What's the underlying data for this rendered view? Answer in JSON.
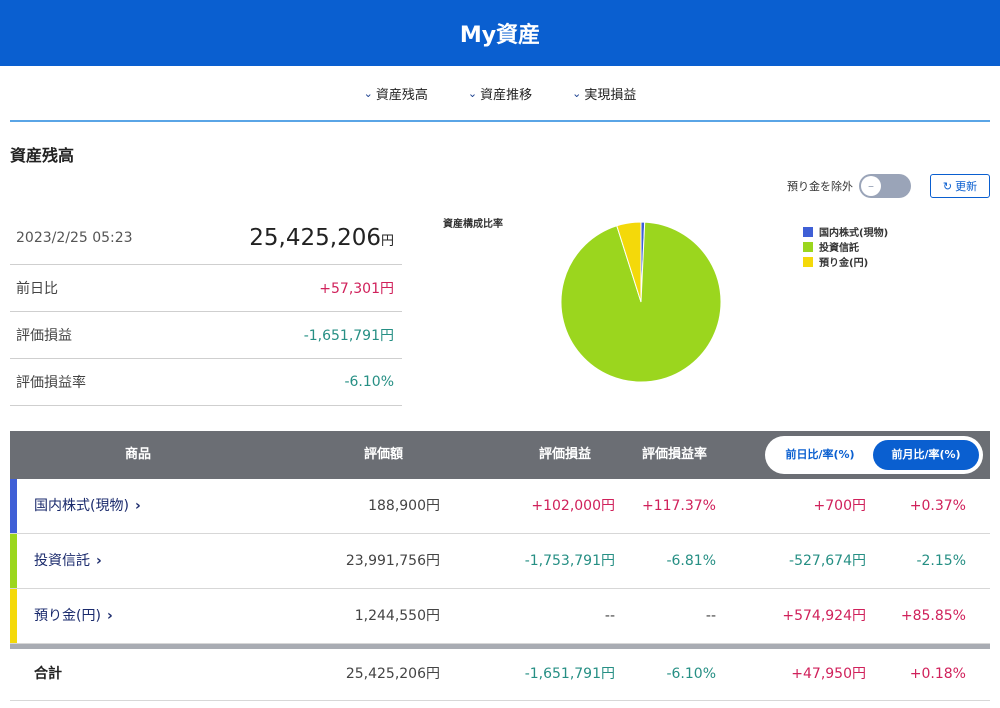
{
  "header": {
    "title": "My資産"
  },
  "tabs": [
    {
      "label": "資産残高"
    },
    {
      "label": "資産推移"
    },
    {
      "label": "実現損益"
    }
  ],
  "section": {
    "title": "資産残高"
  },
  "controls": {
    "exclude_deposit_label": "預り金を除外",
    "refresh_label": "更新"
  },
  "summary": {
    "datetime": "2023/2/25 05:23",
    "total_value": "25,425,206",
    "unit": "円",
    "rows": [
      {
        "label": "前日比",
        "value": "+57,301円"
      },
      {
        "label": "評価損益",
        "value": "-1,651,791円"
      },
      {
        "label": "評価損益率",
        "value": "-6.10%"
      }
    ]
  },
  "chart_data": {
    "type": "pie",
    "title": "資産構成比率",
    "labels": [
      "国内株式(現物)",
      "投資信託",
      "預り金(円)"
    ],
    "values": [
      188900,
      23991756,
      1244550
    ],
    "colors": [
      "#3f5fd6",
      "#9bd61e",
      "#f4d90a"
    ]
  },
  "table": {
    "headers": {
      "product": "商品",
      "value": "評価額",
      "pl": "評価損益",
      "pl_rate": "評価損益率"
    },
    "toggle": {
      "day": "前日比/率(%)",
      "month": "前月比/率(%)"
    },
    "rows": [
      {
        "name": "国内株式(現物)",
        "value": "188,900円",
        "pl": "+102,000円",
        "pl_rate": "+117.37%",
        "change": "+700円",
        "change_rate": "+0.37%",
        "color": "#3f5fd6"
      },
      {
        "name": "投資信託",
        "value": "23,991,756円",
        "pl": "-1,753,791円",
        "pl_rate": "-6.81%",
        "change": "-527,674円",
        "change_rate": "-2.15%",
        "color": "#9bd61e"
      },
      {
        "name": "預り金(円)",
        "value": "1,244,550円",
        "pl": "--",
        "pl_rate": "--",
        "change": "+574,924円",
        "change_rate": "+85.85%",
        "color": "#f4d90a"
      }
    ],
    "total": {
      "name": "合計",
      "value": "25,425,206円",
      "pl": "-1,651,791円",
      "pl_rate": "-6.10%",
      "change": "+47,950円",
      "change_rate": "+0.18%"
    }
  },
  "icons": {
    "tab_chevron": "chevron-down-icon",
    "refresh": "refresh-icon",
    "row_arrow": "chevron-right-icon"
  }
}
